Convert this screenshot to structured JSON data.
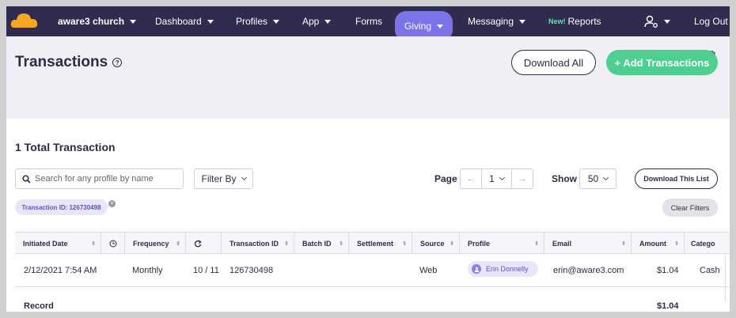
{
  "nav": {
    "org_label": "aware3 church",
    "items": [
      "Dashboard",
      "Profiles",
      "App",
      "Forms",
      "Giving",
      "Messaging"
    ],
    "new_badge": "New!",
    "reports_label": "Reports",
    "logout_label": "Log Out"
  },
  "header": {
    "title": "Transactions",
    "help_glyph": "?",
    "download_all_label": "Download All",
    "add_label": "+ Add Transactions"
  },
  "summary": {
    "total_label": "1 Total Transaction"
  },
  "controls": {
    "search_placeholder": "Search for any profile by name",
    "filter_label": "Filter By",
    "page_label": "Page",
    "page_value": "1",
    "show_label": "Show",
    "show_value": "50",
    "download_list_label": "Download This List",
    "chip_label": "Transaction ID: 126730498",
    "clear_filters_label": "Clear Filters"
  },
  "table": {
    "columns": [
      "Initiated Date",
      "",
      "Frequency",
      "",
      "Transaction ID",
      "Batch ID",
      "Settlement",
      "Source",
      "Profile",
      "Email",
      "Amount",
      "Catego"
    ],
    "row": {
      "date": "2/12/2021 7:54 AM",
      "frequency": "Monthly",
      "recurrence": "10 / 11",
      "transaction_id": "126730498",
      "source": "Web",
      "profile": "Erin Donnelly",
      "email": "erin@aware3.com",
      "amount": "$1.04",
      "category": "Cash"
    },
    "footer": {
      "label": "Record",
      "amount": "$1.04"
    }
  },
  "colors": {
    "nav_bg": "#2f2c4f",
    "accent": "#7b73e8",
    "green": "#4fcf8f",
    "header_bg": "#efeff5"
  }
}
